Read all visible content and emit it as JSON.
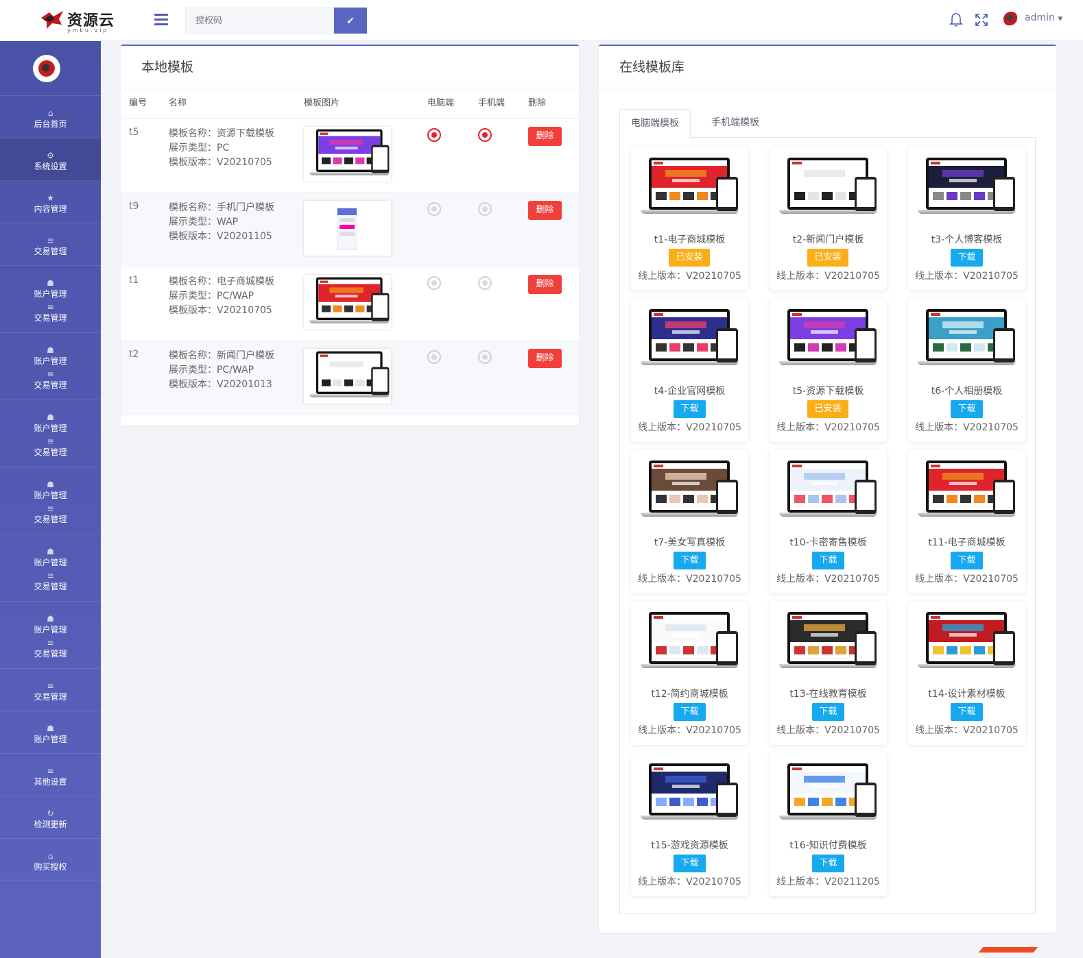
{
  "app": {
    "brand": "资源云",
    "brand_sub": "ymku.vip"
  },
  "topbar": {
    "license_placeholder": "授权码",
    "user": "admin"
  },
  "sidebar": {
    "items": [
      {
        "icon": "home-icon",
        "label": "后台首页"
      },
      {
        "icon": "gear-icon",
        "label": "系统设置",
        "active": true
      },
      {
        "icon": "star-icon",
        "label": "内容管理"
      },
      {
        "icon": "list-icon",
        "label": "交易管理"
      },
      {
        "icon": "users-icon",
        "label": "账户管理",
        "sub": "交易管理"
      },
      {
        "icon": "users-icon",
        "label": "账户管理",
        "sub": "交易管理"
      },
      {
        "icon": "users-icon",
        "label": "账户管理",
        "sub": "交易管理"
      },
      {
        "icon": "users-icon",
        "label": "账户管理",
        "sub": "交易管理"
      },
      {
        "icon": "users-icon",
        "label": "账户管理",
        "sub": "交易管理"
      },
      {
        "icon": "users-icon",
        "label": "账户管理",
        "sub": "交易管理"
      },
      {
        "icon": "list-icon",
        "label": "交易管理"
      },
      {
        "icon": "users-icon",
        "label": "账户管理"
      },
      {
        "icon": "list-icon",
        "label": "其他设置"
      },
      {
        "icon": "refresh-icon",
        "label": "检测更新"
      },
      {
        "icon": "home-icon",
        "label": "购买授权"
      }
    ]
  },
  "local": {
    "title": "本地模板",
    "headers": {
      "id": "编号",
      "name": "名称",
      "image": "模板图片",
      "pc": "电脑端",
      "mobile": "手机端",
      "delete": "删除"
    },
    "delete_label": "删除",
    "rows": [
      {
        "id": "t5",
        "line1": "模板名称：资源下载模板",
        "line2": "展示类型：PC",
        "line3": "模板版本：V20210705",
        "pc": true,
        "mobile": true,
        "theme": "purple"
      },
      {
        "id": "t9",
        "line1": "模板名称：手机门户模板",
        "line2": "展示类型：WAP",
        "line3": "模板版本：V20201105",
        "pc": false,
        "mobile": false,
        "theme": "phone"
      },
      {
        "id": "t1",
        "line1": "模板名称：电子商城模板",
        "line2": "展示类型：PC/WAP",
        "line3": "模板版本：V20210705",
        "pc": false,
        "mobile": false,
        "theme": "red"
      },
      {
        "id": "t2",
        "line1": "模板名称：新闻门户模板",
        "line2": "展示类型：PC/WAP",
        "line3": "模板版本：V20201013",
        "pc": false,
        "mobile": false,
        "theme": "news"
      }
    ]
  },
  "online": {
    "title": "在线模板库",
    "tabs": [
      "电脑端模板",
      "手机端模板"
    ],
    "download_label": "下载",
    "installed_label": "已安装",
    "templates": [
      {
        "name": "t1-电子商城模板",
        "status": "installed",
        "version": "线上版本：V20210705",
        "theme": "red"
      },
      {
        "name": "t2-新闻门户模板",
        "status": "installed",
        "version": "线上版本：V20210705",
        "theme": "news"
      },
      {
        "name": "t3-个人博客模板",
        "status": "download",
        "version": "线上版本：V20210705",
        "theme": "dark"
      },
      {
        "name": "t4-企业官网模板",
        "status": "download",
        "version": "线上版本：V20210705",
        "theme": "indigo"
      },
      {
        "name": "t5-资源下载模板",
        "status": "installed",
        "version": "线上版本：V20210705",
        "theme": "purple"
      },
      {
        "name": "t6-个人相册模板",
        "status": "download",
        "version": "线上版本：V20210705",
        "theme": "sea"
      },
      {
        "name": "t7-美女写真模板",
        "status": "download",
        "version": "线上版本：V20210705",
        "theme": "photo"
      },
      {
        "name": "t10-卡密寄售模板",
        "status": "download",
        "version": "线上版本：V20210705",
        "theme": "light"
      },
      {
        "name": "t11-电子商城模板",
        "status": "download",
        "version": "线上版本：V20210705",
        "theme": "red"
      },
      {
        "name": "t12-简约商城模板",
        "status": "download",
        "version": "线上版本：V20210705",
        "theme": "simple"
      },
      {
        "name": "t13-在线教育模板",
        "status": "download",
        "version": "线上版本：V20210705",
        "theme": "edu"
      },
      {
        "name": "t14-设计素材模板",
        "status": "download",
        "version": "线上版本：V20210705",
        "theme": "design"
      },
      {
        "name": "t15-游戏资源模板",
        "status": "download",
        "version": "线上版本：V20210705",
        "theme": "game"
      },
      {
        "name": "t16-知识付费模板",
        "status": "download",
        "version": "线上版本：V20211205",
        "theme": "know"
      }
    ]
  },
  "colors": {
    "accent": "#5865c2",
    "danger": "#f0403c",
    "download": "#17a9ef",
    "installed": "#fbae17"
  }
}
